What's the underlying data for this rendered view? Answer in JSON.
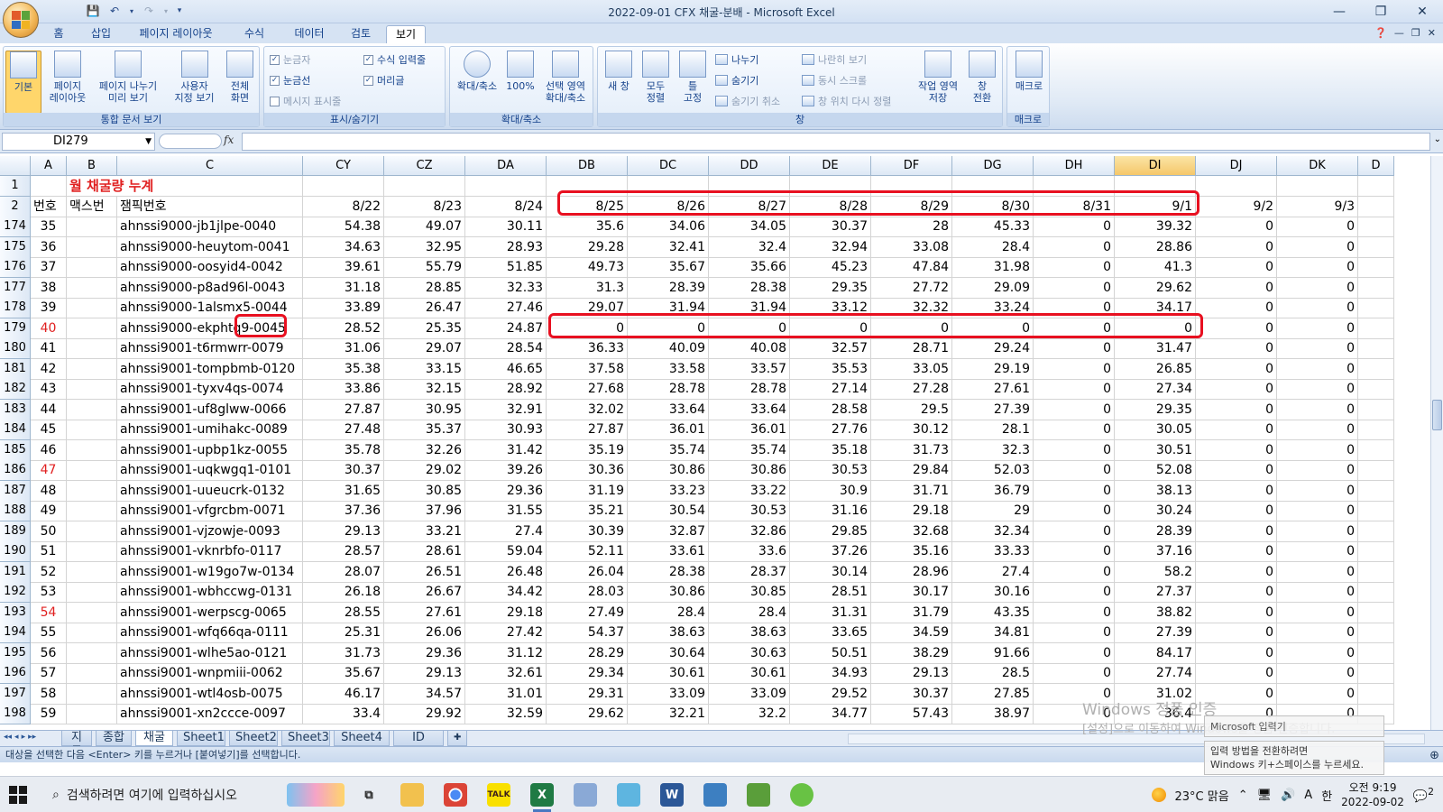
{
  "window": {
    "title": "2022-09-01  CFX 채굴-분배 - Microsoft Excel",
    "controls": [
      "—",
      "❐",
      "✕"
    ]
  },
  "ribbon": {
    "tabs": [
      "홈",
      "삽입",
      "페이지 레이아웃",
      "수식",
      "데이터",
      "검토",
      "보기"
    ],
    "active_tab": "보기",
    "groups": {
      "workbook_views": {
        "title": "통합 문서 보기",
        "normal": "기본",
        "page_layout": [
          "페이지",
          "레이아웃"
        ],
        "page_break": [
          "페이지 나누기",
          "미리 보기"
        ],
        "custom_views": [
          "사용자",
          "지정 보기"
        ],
        "full_screen": [
          "전체",
          "화면"
        ]
      },
      "show_hide": {
        "title": "표시/숨기기",
        "ruler": "눈금자",
        "gridlines": "눈금선",
        "message_bar": "메시지 표시줄",
        "formula_bar": "수식 입력줄",
        "headings": "머리글"
      },
      "zoom": {
        "title": "확대/축소",
        "zoom": "확대/축소",
        "hundred": "100%",
        "to_selection": [
          "선택 영역",
          "확대/축소"
        ]
      },
      "window": {
        "title": "창",
        "new_window": [
          "새 창"
        ],
        "arrange_all": [
          "모두",
          "정렬"
        ],
        "freeze_panes": [
          "틀",
          "고정"
        ],
        "split": "나누기",
        "hide": "숨기기",
        "unhide": "숨기기 취소",
        "side_by_side": "나란히 보기",
        "sync_scroll": "동시 스크롤",
        "reset_position": "창 위치 다시 정렬",
        "save_workspace": [
          "작업 영역",
          "저장"
        ],
        "switch_windows": [
          "창",
          "전환"
        ]
      },
      "macros": {
        "title": "매크로",
        "macros": "매크로"
      }
    }
  },
  "formula_bar": {
    "name_box": "DI279",
    "fx": "fx",
    "formula": ""
  },
  "grid": {
    "columns": [
      "A",
      "B",
      "C",
      "CY",
      "CZ",
      "DA",
      "DB",
      "DC",
      "DD",
      "DE",
      "DF",
      "DG",
      "DH",
      "DI",
      "DJ",
      "DK",
      "D"
    ],
    "selected_column": "DI",
    "title_row": {
      "row": "1",
      "text": "월 채굴량 누계"
    },
    "header_row": {
      "row": "2",
      "labels": [
        "번호",
        "맥스번",
        "잼픽번호"
      ],
      "dates": [
        "8/22",
        "8/23",
        "8/24",
        "8/25",
        "8/26",
        "8/27",
        "8/28",
        "8/29",
        "8/30",
        "8/31",
        "9/1",
        "9/2",
        "9/3"
      ]
    },
    "rows": [
      {
        "r": "174",
        "a": "35",
        "c": "ahnssi9000-jb1jlpe-0040",
        "v": [
          "54.38",
          "49.07",
          "30.11",
          "35.6",
          "34.06",
          "34.05",
          "30.37",
          "28",
          "45.33",
          "0",
          "39.32",
          "0",
          "0"
        ]
      },
      {
        "r": "175",
        "a": "36",
        "c": "ahnssi9000-heuytom-0041",
        "v": [
          "34.63",
          "32.95",
          "28.93",
          "29.28",
          "32.41",
          "32.4",
          "32.94",
          "33.08",
          "28.4",
          "0",
          "28.86",
          "0",
          "0"
        ]
      },
      {
        "r": "176",
        "a": "37",
        "c": "ahnssi9000-oosyid4-0042",
        "v": [
          "39.61",
          "55.79",
          "51.85",
          "49.73",
          "35.67",
          "35.66",
          "45.23",
          "47.84",
          "31.98",
          "0",
          "41.3",
          "0",
          "0"
        ]
      },
      {
        "r": "177",
        "a": "38",
        "c": "ahnssi9000-p8ad96l-0043",
        "v": [
          "31.18",
          "28.85",
          "32.33",
          "31.3",
          "28.39",
          "28.38",
          "29.35",
          "27.72",
          "29.09",
          "0",
          "29.62",
          "0",
          "0"
        ]
      },
      {
        "r": "178",
        "a": "39",
        "c": "ahnssi9000-1alsmx5-0044",
        "v": [
          "33.89",
          "26.47",
          "27.46",
          "29.07",
          "31.94",
          "31.94",
          "33.12",
          "32.32",
          "33.24",
          "0",
          "34.17",
          "0",
          "0"
        ]
      },
      {
        "r": "179",
        "a": "40",
        "red": true,
        "c": "ahnssi9000-ekphtq9-0045",
        "v": [
          "28.52",
          "25.35",
          "24.87",
          "0",
          "0",
          "0",
          "0",
          "0",
          "0",
          "0",
          "0",
          "0",
          "0"
        ]
      },
      {
        "r": "180",
        "a": "41",
        "c": "ahnssi9001-t6rmwrr-0079",
        "v": [
          "31.06",
          "29.07",
          "28.54",
          "36.33",
          "40.09",
          "40.08",
          "32.57",
          "28.71",
          "29.24",
          "0",
          "31.47",
          "0",
          "0"
        ]
      },
      {
        "r": "181",
        "a": "42",
        "c": "ahnssi9001-tompbmb-0120",
        "v": [
          "35.38",
          "33.15",
          "46.65",
          "37.58",
          "33.58",
          "33.57",
          "35.53",
          "33.05",
          "29.19",
          "0",
          "26.85",
          "0",
          "0"
        ]
      },
      {
        "r": "182",
        "a": "43",
        "c": "ahnssi9001-tyxv4qs-0074",
        "v": [
          "33.86",
          "32.15",
          "28.92",
          "27.68",
          "28.78",
          "28.78",
          "27.14",
          "27.28",
          "27.61",
          "0",
          "27.34",
          "0",
          "0"
        ]
      },
      {
        "r": "183",
        "a": "44",
        "c": "ahnssi9001-uf8glww-0066",
        "v": [
          "27.87",
          "30.95",
          "32.91",
          "32.02",
          "33.64",
          "33.64",
          "28.58",
          "29.5",
          "27.39",
          "0",
          "29.35",
          "0",
          "0"
        ]
      },
      {
        "r": "184",
        "a": "45",
        "c": "ahnssi9001-umihakc-0089",
        "v": [
          "27.48",
          "35.37",
          "30.93",
          "27.87",
          "36.01",
          "36.01",
          "27.76",
          "30.12",
          "28.1",
          "0",
          "30.05",
          "0",
          "0"
        ]
      },
      {
        "r": "185",
        "a": "46",
        "c": "ahnssi9001-upbp1kz-0055",
        "v": [
          "35.78",
          "32.26",
          "31.42",
          "35.19",
          "35.74",
          "35.74",
          "35.18",
          "31.73",
          "32.3",
          "0",
          "30.51",
          "0",
          "0"
        ]
      },
      {
        "r": "186",
        "a": "47",
        "red": true,
        "c": "ahnssi9001-uqkwgq1-0101",
        "v": [
          "30.37",
          "29.02",
          "39.26",
          "30.36",
          "30.86",
          "30.86",
          "30.53",
          "29.84",
          "52.03",
          "0",
          "52.08",
          "0",
          "0"
        ]
      },
      {
        "r": "187",
        "a": "48",
        "c": "ahnssi9001-uueucrk-0132",
        "v": [
          "31.65",
          "30.85",
          "29.36",
          "31.19",
          "33.23",
          "33.22",
          "30.9",
          "31.71",
          "36.79",
          "0",
          "38.13",
          "0",
          "0"
        ]
      },
      {
        "r": "188",
        "a": "49",
        "c": "ahnssi9001-vfgrcbm-0071",
        "v": [
          "37.36",
          "37.96",
          "31.55",
          "35.21",
          "30.54",
          "30.53",
          "31.16",
          "29.18",
          "29",
          "0",
          "30.24",
          "0",
          "0"
        ]
      },
      {
        "r": "189",
        "a": "50",
        "c": "ahnssi9001-vjzowje-0093",
        "v": [
          "29.13",
          "33.21",
          "27.4",
          "30.39",
          "32.87",
          "32.86",
          "29.85",
          "32.68",
          "32.34",
          "0",
          "28.39",
          "0",
          "0"
        ]
      },
      {
        "r": "190",
        "a": "51",
        "c": "ahnssi9001-vknrbfo-0117",
        "v": [
          "28.57",
          "28.61",
          "59.04",
          "52.11",
          "33.61",
          "33.6",
          "37.26",
          "35.16",
          "33.33",
          "0",
          "37.16",
          "0",
          "0"
        ]
      },
      {
        "r": "191",
        "a": "52",
        "c": "ahnssi9001-w19go7w-0134",
        "v": [
          "28.07",
          "26.51",
          "26.48",
          "26.04",
          "28.38",
          "28.37",
          "30.14",
          "28.96",
          "27.4",
          "0",
          "58.2",
          "0",
          "0"
        ]
      },
      {
        "r": "192",
        "a": "53",
        "c": "ahnssi9001-wbhccwg-0131",
        "v": [
          "26.18",
          "26.67",
          "34.42",
          "28.03",
          "30.86",
          "30.85",
          "28.51",
          "30.17",
          "30.16",
          "0",
          "27.37",
          "0",
          "0"
        ]
      },
      {
        "r": "193",
        "a": "54",
        "red": true,
        "c": "ahnssi9001-werpscg-0065",
        "v": [
          "28.55",
          "27.61",
          "29.18",
          "27.49",
          "28.4",
          "28.4",
          "31.31",
          "31.79",
          "43.35",
          "0",
          "38.82",
          "0",
          "0"
        ]
      },
      {
        "r": "194",
        "a": "55",
        "c": "ahnssi9001-wfq66qa-0111",
        "v": [
          "25.31",
          "26.06",
          "27.42",
          "54.37",
          "38.63",
          "38.63",
          "33.65",
          "34.59",
          "34.81",
          "0",
          "27.39",
          "0",
          "0"
        ]
      },
      {
        "r": "195",
        "a": "56",
        "c": "ahnssi9001-wlhe5ao-0121",
        "v": [
          "31.73",
          "29.36",
          "31.12",
          "28.29",
          "30.64",
          "30.63",
          "50.51",
          "38.29",
          "91.66",
          "0",
          "84.17",
          "0",
          "0"
        ]
      },
      {
        "r": "196",
        "a": "57",
        "c": "ahnssi9001-wnpmiii-0062",
        "v": [
          "35.67",
          "29.13",
          "32.61",
          "29.34",
          "30.61",
          "30.61",
          "34.93",
          "29.13",
          "28.5",
          "0",
          "27.74",
          "0",
          "0"
        ]
      },
      {
        "r": "197",
        "a": "58",
        "c": "ahnssi9001-wtl4osb-0075",
        "v": [
          "46.17",
          "34.57",
          "31.01",
          "29.31",
          "33.09",
          "33.09",
          "29.52",
          "30.37",
          "27.85",
          "0",
          "31.02",
          "0",
          "0"
        ]
      },
      {
        "r": "198",
        "a": "59",
        "c": "ahnssi9001-xn2ccce-0097",
        "v": [
          "33.4",
          "29.92",
          "32.59",
          "29.62",
          "32.21",
          "32.2",
          "34.77",
          "57.43",
          "38.97",
          "0",
          "36.4",
          "0",
          "0"
        ]
      }
    ]
  },
  "sheets": {
    "nav": [
      "◂◂",
      "◂",
      "▸",
      "▸▸"
    ],
    "tabs": [
      "지급",
      "종합",
      "채굴",
      "Sheet1",
      "Sheet2",
      "Sheet3",
      "Sheet4",
      "ID KEY"
    ],
    "active": "채굴"
  },
  "status_bar": {
    "message": "대상을 선택한 다음 <Enter> 키를 누르거나 [붙여넣기]를 선택합니다."
  },
  "overlays": {
    "watermark_line1": "Windows 정품 인증",
    "watermark_line2": "[설정]으로 이동하여 Windows를 정품 인증합니다.",
    "ime_popup_1": "Microsoft 입력기",
    "ime_popup_2a": "입력 방법을 전환하려면",
    "ime_popup_2b": "Windows 키+스페이스를 누르세요."
  },
  "taskbar": {
    "search_placeholder": "검색하려면 여기에 입력하십시오",
    "weather": "23°C  맑음",
    "ime": "A",
    "lang": "한",
    "time": "오전 9:19",
    "date": "2022-09-02",
    "notifications": "2"
  }
}
